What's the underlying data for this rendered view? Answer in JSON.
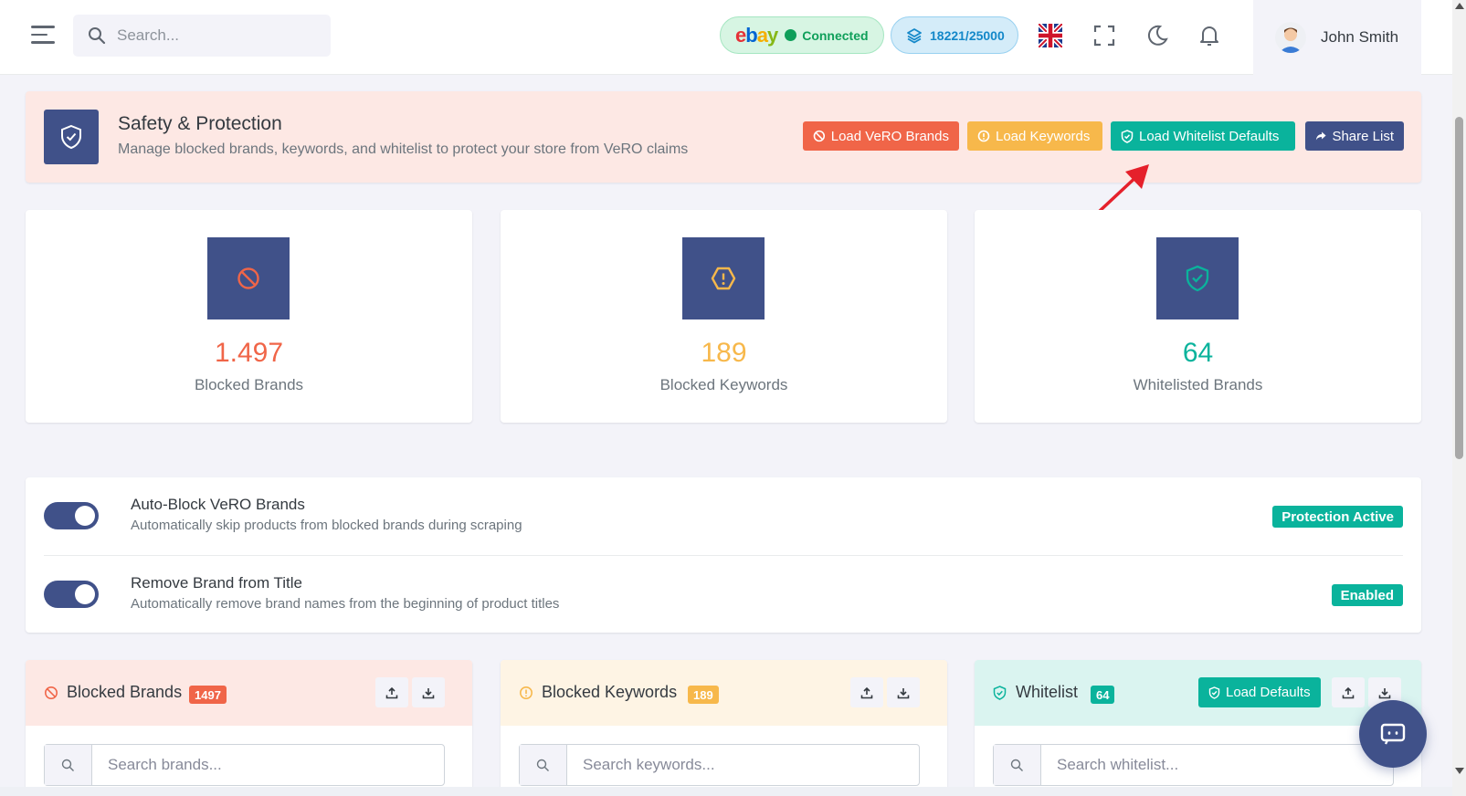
{
  "header": {
    "search_placeholder": "Search...",
    "ebay_status": "Connected",
    "credits": "18221/25000",
    "user_name": "John Smith"
  },
  "banner": {
    "title": "Safety & Protection",
    "subtitle": "Manage blocked brands, keywords, and whitelist to protect your store from VeRO claims",
    "buttons": {
      "load_vero": "Load VeRO Brands",
      "load_keywords": "Load Keywords",
      "load_whitelist": "Load Whitelist Defaults",
      "share": "Share List"
    }
  },
  "stats": [
    {
      "value": "1.497",
      "label": "Blocked Brands",
      "color": "#f06548"
    },
    {
      "value": "189",
      "label": "Blocked Keywords",
      "color": "#f7b84b"
    },
    {
      "value": "64",
      "label": "Whitelisted Brands",
      "color": "#0ab39c"
    }
  ],
  "toggles": [
    {
      "title": "Auto-Block VeRO Brands",
      "subtitle": "Automatically skip products from blocked brands during scraping",
      "badge": "Protection Active",
      "on": true
    },
    {
      "title": "Remove Brand from Title",
      "subtitle": "Automatically remove brand names from the beginning of product titles",
      "badge": "Enabled",
      "on": true
    }
  ],
  "panels": [
    {
      "title": "Blocked Brands",
      "count": "1497",
      "search_placeholder": "Search brands..."
    },
    {
      "title": "Blocked Keywords",
      "count": "189",
      "search_placeholder": "Search keywords..."
    },
    {
      "title": "Whitelist",
      "count": "64",
      "search_placeholder": "Search whitelist...",
      "load_defaults": "Load Defaults"
    }
  ],
  "colors": {
    "primary": "#405189",
    "danger": "#f06548",
    "warning": "#f7b84b",
    "success": "#0ab39c"
  }
}
